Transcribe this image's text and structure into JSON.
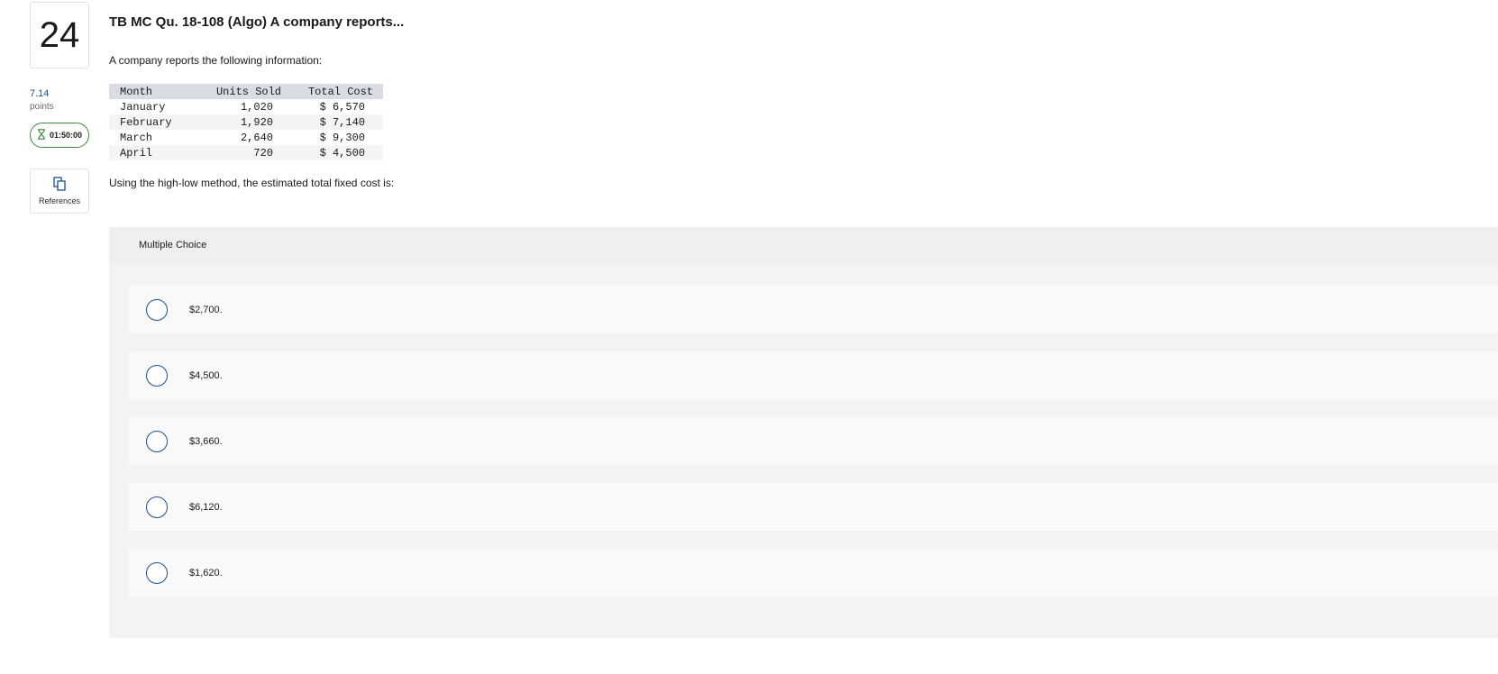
{
  "question": {
    "number": "24",
    "points_value": "7.14",
    "points_label": "points",
    "timer": "01:50:00",
    "references_label": "References",
    "title": "TB MC Qu. 18-108 (Algo) A company reports...",
    "intro": "A company reports the following information:",
    "prompt": "Using the high-low method, the estimated total fixed cost is:"
  },
  "table": {
    "headers": [
      "Month",
      "Units Sold",
      "Total Cost"
    ],
    "rows": [
      [
        "January",
        "1,020",
        "$ 6,570"
      ],
      [
        "February",
        "1,920",
        "$ 7,140"
      ],
      [
        "March",
        "2,640",
        "$ 9,300"
      ],
      [
        "April",
        "720",
        "$ 4,500"
      ]
    ]
  },
  "multiple_choice": {
    "header": "Multiple Choice",
    "options": [
      "$2,700.",
      "$4,500.",
      "$3,660.",
      "$6,120.",
      "$1,620."
    ]
  },
  "colors": {
    "accent_blue": "#1b4f8f",
    "timer_green": "#3f8a3f",
    "table_header_bg": "#d9dce3",
    "panel_bg": "#f3f3f3"
  },
  "icons": {
    "timer": "hourglass-icon",
    "references": "copy-documents-icon",
    "option": "radio-button-icon"
  }
}
